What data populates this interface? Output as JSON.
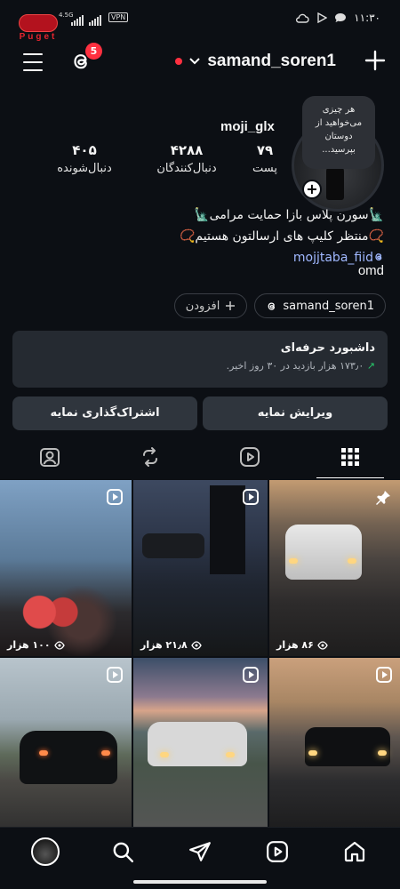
{
  "status_bar": {
    "time": "۱۱:۳۰",
    "network": "4.5G",
    "vpn": "VPN",
    "app_logo_text": "Puget"
  },
  "header": {
    "username": "samand_soren1",
    "threads_badge": "5"
  },
  "profile": {
    "display_name": "moji_glx",
    "note": "هر چیزی می‌خواهید از دوستان بپرسید...",
    "stats": {
      "posts_value": "۷۹",
      "posts_label": "پست",
      "followers_value": "۴۲۸۸",
      "followers_label": "دنبال‌کنندگان",
      "following_value": "۴۰۵",
      "following_label": "دنبال‌شونده"
    },
    "bio_line1": "🗽سورن پلاس بازا حمایت مرامی🗽",
    "bio_line2": "📿منتظر کلیپ های ارسالتون هستیم📿",
    "bio_link": "mojjtaba_fiid",
    "bio_tag": "omd"
  },
  "chips": {
    "threads_username": "samand_soren1",
    "add_label": "افزودن"
  },
  "dashboard": {
    "title": "داشبورد حرفه‌ای",
    "arrow": "↗",
    "subtitle": "۱۷۳٫۰ هزار بازدید در ۳۰ روز اخیر."
  },
  "buttons": {
    "edit_label": "ویرایش نمایه",
    "share_label": "اشتراک‌گذاری نمایه"
  },
  "grid": [
    {
      "views": "۸۶ هزار",
      "pinned": true
    },
    {
      "views": "۲۱٫۸ هزار",
      "reel": true
    },
    {
      "views": "۱۰۰ هزار",
      "reel": true
    },
    {
      "views": "",
      "reel": true
    },
    {
      "views": "",
      "reel": true
    },
    {
      "views": "",
      "reel": true
    }
  ]
}
